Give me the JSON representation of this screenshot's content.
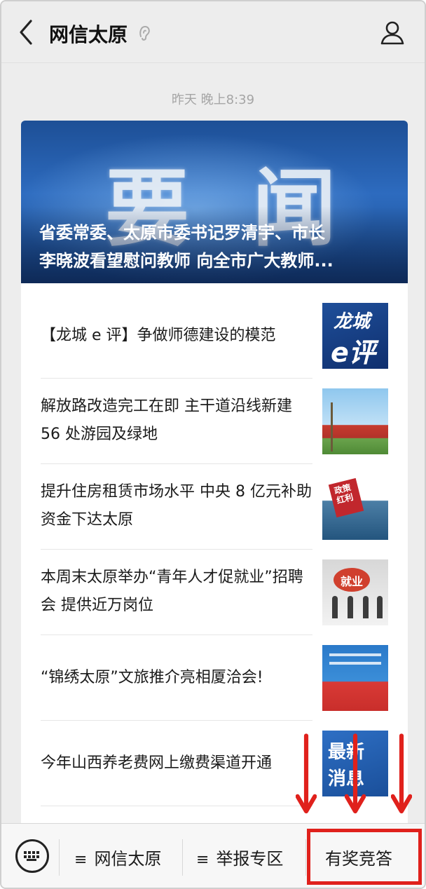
{
  "header": {
    "title": "网信太原",
    "back_icon": "chevron-left-icon",
    "profile_icon": "user-profile-icon"
  },
  "timestamp": "昨天 晚上8:39",
  "feed": {
    "banner": {
      "big_text": "要闻",
      "headline_line1": "省委常委、太原市委书记罗清宇、市长",
      "headline_line2": "李晓波看望慰问教师 向全市广大教师..."
    },
    "items": [
      {
        "title": "【龙城 e 评】争做师德建设的模范",
        "thumb_text_1": "龙城",
        "thumb_text_2": "e评"
      },
      {
        "title": "解放路改造完工在即 主干道沿线新建 56 处游园及绿地"
      },
      {
        "title": "提升住房租赁市场水平 中央 8 亿元补助资金下达太原",
        "thumb_text": "政策红利"
      },
      {
        "title": "本周末太原举办“青年人才促就业”招聘会 提供近万岗位",
        "thumb_text": "就业"
      },
      {
        "title": "“锦绣太原”文旅推介亮相厦洽会!"
      },
      {
        "title": "今年山西养老费网上缴费渠道开通",
        "thumb_text_1": "最新",
        "thumb_text_2": "消息"
      }
    ]
  },
  "menu": {
    "keyboard_icon": "keyboard-icon",
    "items": [
      {
        "label": "网信太原",
        "has_submenu": true
      },
      {
        "label": "举报专区",
        "has_submenu": true
      },
      {
        "label": "有奖竞答",
        "has_submenu": false
      }
    ]
  },
  "annotation": {
    "arrow_color": "#e0211c",
    "box_color": "#e0211c"
  }
}
